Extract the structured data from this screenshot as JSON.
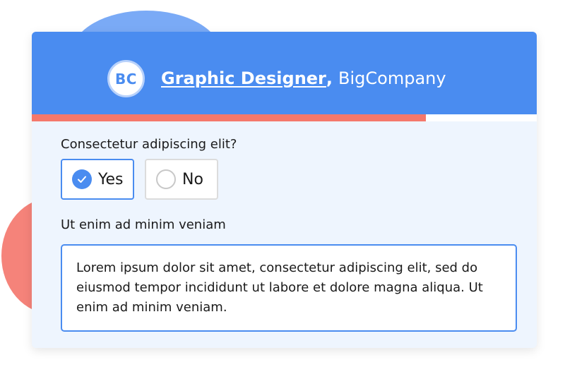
{
  "header": {
    "badge_text": "BC",
    "job_title": "Graphic Designer",
    "separator": ",",
    "company": "BigCompany"
  },
  "progress": {
    "fraction": 0.78
  },
  "question1": {
    "text": "Consectetur adipiscing elit?",
    "options": [
      {
        "label": "Yes",
        "selected": true
      },
      {
        "label": "No",
        "selected": false
      }
    ]
  },
  "question2": {
    "text": "Ut enim ad minim veniam",
    "answer": "Lorem ipsum dolor sit amet, consectetur adipiscing elit, sed do eiusmod tempor incididunt ut labore et dolore magna aliqua. Ut enim ad minim veniam."
  },
  "colors": {
    "primary": "#4a8cf0",
    "accent": "#f5786b",
    "card_bg": "#eef5fe"
  },
  "icons": {
    "selected_option": "check-icon"
  }
}
